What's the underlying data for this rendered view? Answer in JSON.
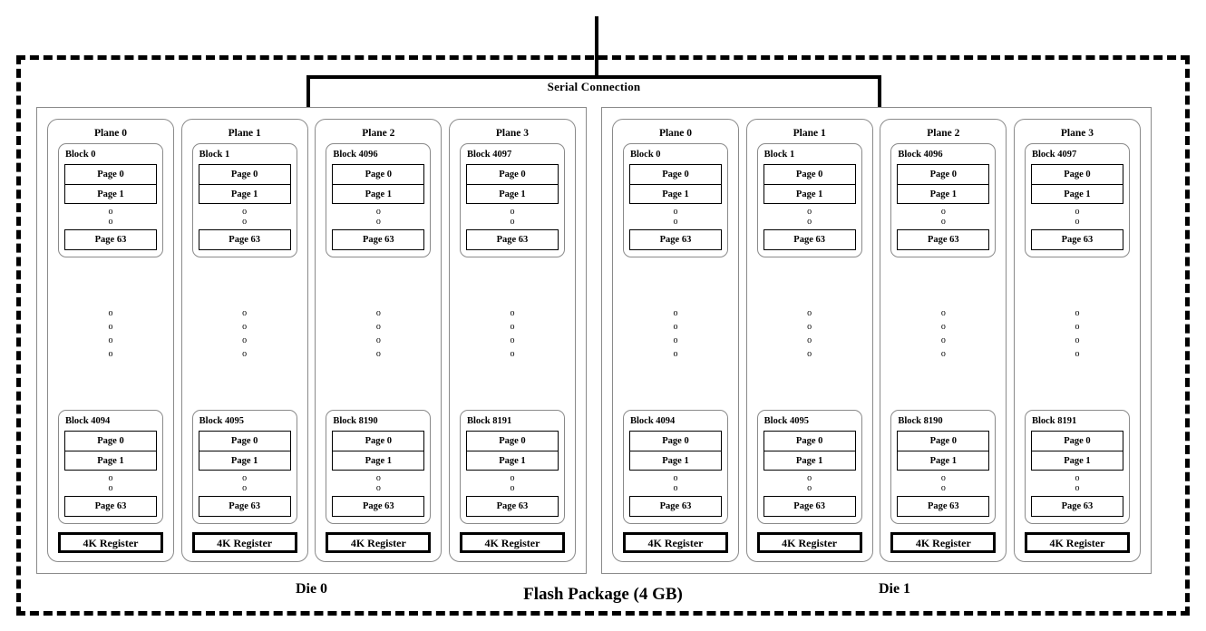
{
  "diagram": {
    "serial_connection_label": "Serial Connection",
    "package_caption": "Flash Package (4 GB)",
    "colors": {
      "line": "#000000",
      "box_outline": "#8a8a8a",
      "background": "#ffffff"
    },
    "dots_glyph": "o"
  },
  "dies": [
    {
      "caption": "Die 0",
      "planes": [
        {
          "title": "Plane 0",
          "top_block": {
            "title": "Block 0",
            "pages": [
              "Page 0",
              "Page 1",
              "Page 63"
            ]
          },
          "bottom_block": {
            "title": "Block 4094",
            "pages": [
              "Page 0",
              "Page 1",
              "Page 63"
            ]
          },
          "register": "4K Register"
        },
        {
          "title": "Plane 1",
          "top_block": {
            "title": "Block 1",
            "pages": [
              "Page 0",
              "Page 1",
              "Page 63"
            ]
          },
          "bottom_block": {
            "title": "Block 4095",
            "pages": [
              "Page 0",
              "Page 1",
              "Page 63"
            ]
          },
          "register": "4K Register"
        },
        {
          "title": "Plane 2",
          "top_block": {
            "title": "Block 4096",
            "pages": [
              "Page 0",
              "Page 1",
              "Page 63"
            ]
          },
          "bottom_block": {
            "title": "Block 8190",
            "pages": [
              "Page 0",
              "Page 1",
              "Page 63"
            ]
          },
          "register": "4K Register"
        },
        {
          "title": "Plane 3",
          "top_block": {
            "title": "Block 4097",
            "pages": [
              "Page 0",
              "Page 1",
              "Page 63"
            ]
          },
          "bottom_block": {
            "title": "Block 8191",
            "pages": [
              "Page 0",
              "Page 1",
              "Page 63"
            ]
          },
          "register": "4K Register"
        }
      ]
    },
    {
      "caption": "Die 1",
      "planes": [
        {
          "title": "Plane 0",
          "top_block": {
            "title": "Block 0",
            "pages": [
              "Page 0",
              "Page 1",
              "Page 63"
            ]
          },
          "bottom_block": {
            "title": "Block 4094",
            "pages": [
              "Page 0",
              "Page 1",
              "Page 63"
            ]
          },
          "register": "4K Register"
        },
        {
          "title": "Plane 1",
          "top_block": {
            "title": "Block 1",
            "pages": [
              "Page 0",
              "Page 1",
              "Page 63"
            ]
          },
          "bottom_block": {
            "title": "Block 4095",
            "pages": [
              "Page 0",
              "Page 1",
              "Page 63"
            ]
          },
          "register": "4K Register"
        },
        {
          "title": "Plane 2",
          "top_block": {
            "title": "Block 4096",
            "pages": [
              "Page 0",
              "Page 1",
              "Page 63"
            ]
          },
          "bottom_block": {
            "title": "Block 8190",
            "pages": [
              "Page 0",
              "Page 1",
              "Page 63"
            ]
          },
          "register": "4K Register"
        },
        {
          "title": "Plane 3",
          "top_block": {
            "title": "Block 4097",
            "pages": [
              "Page 0",
              "Page 1",
              "Page 63"
            ]
          },
          "bottom_block": {
            "title": "Block 8191",
            "pages": [
              "Page 0",
              "Page 1",
              "Page 63"
            ]
          },
          "register": "4K Register"
        }
      ]
    }
  ]
}
